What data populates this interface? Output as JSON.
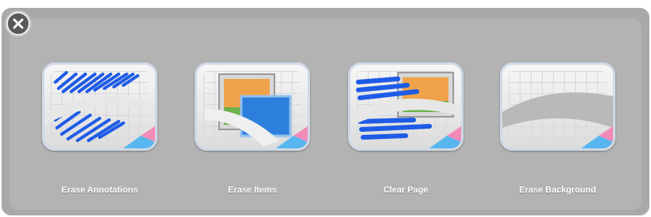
{
  "dialog": {
    "close_icon": "close-x-icon",
    "options": [
      {
        "label": "Erase Annotations",
        "icon": "erase-annotations-icon"
      },
      {
        "label": "Erase Items",
        "icon": "erase-items-icon"
      },
      {
        "label": "Clear Page",
        "icon": "clear-page-icon"
      },
      {
        "label": "Erase Background",
        "icon": "erase-background-icon"
      }
    ]
  },
  "colors": {
    "panel": "#a9a9a9",
    "ink_blue": "#1e5be6",
    "eraser_pink": "#f28bb8",
    "eraser_blue": "#58b6ee"
  }
}
